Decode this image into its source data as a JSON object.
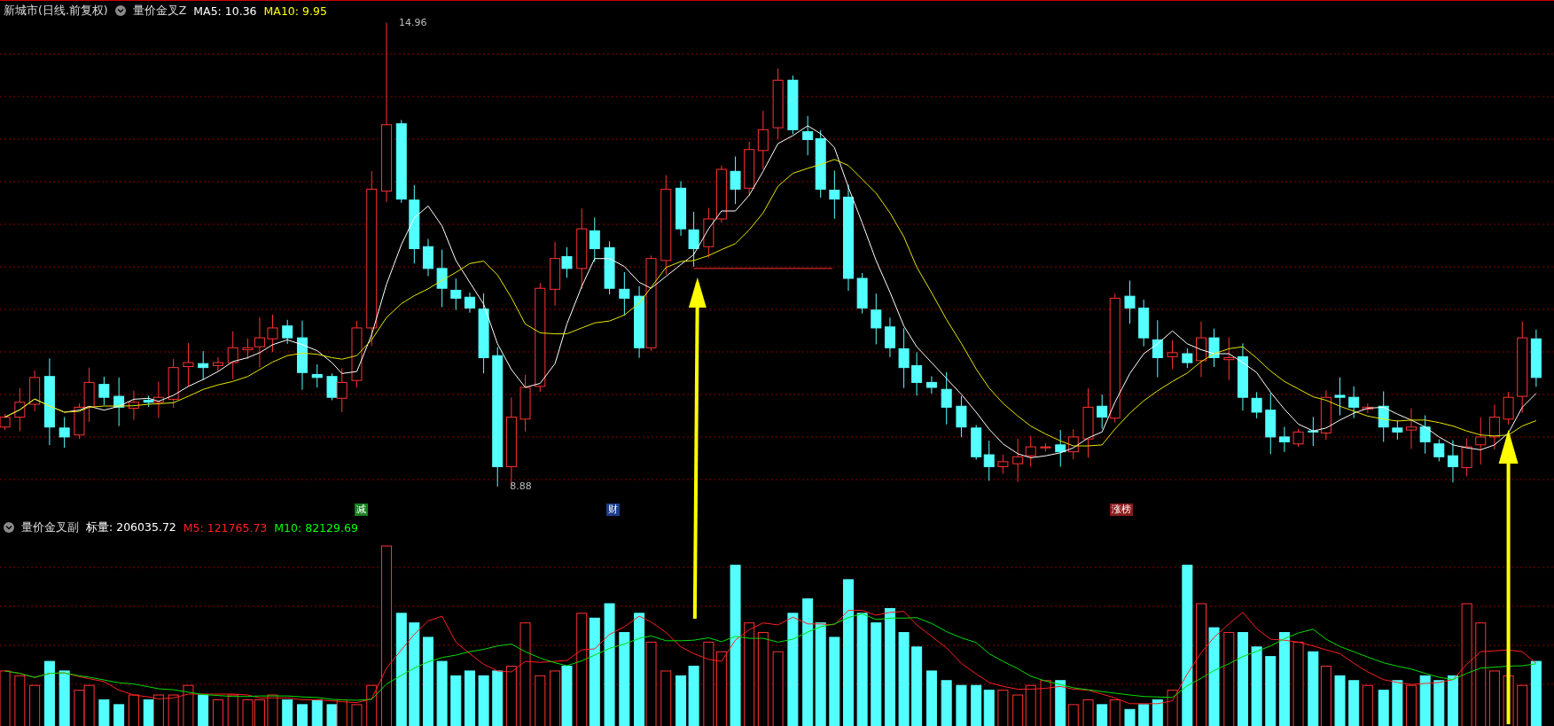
{
  "chart_header": {
    "title": "新城市(日线.前复权)",
    "indicator": "量价金叉Z",
    "ma5": "MA5: 10.36",
    "ma10": "MA10: 9.95"
  },
  "price_markers": [
    {
      "kind": "high",
      "label": "14.96"
    },
    {
      "kind": "low",
      "label": "8.88"
    }
  ],
  "signal_tags": [
    {
      "label": "减",
      "color": "#17801e"
    },
    {
      "label": "财",
      "color": "#1d3d8c"
    },
    {
      "label": "涨榜",
      "color": "#8a1c1c"
    }
  ],
  "volume_header": {
    "indicator": "量价金叉副",
    "volume": "标量: 206035.72",
    "m5": "M5: 121765.73",
    "m10": "M10: 82129.69"
  }
}
